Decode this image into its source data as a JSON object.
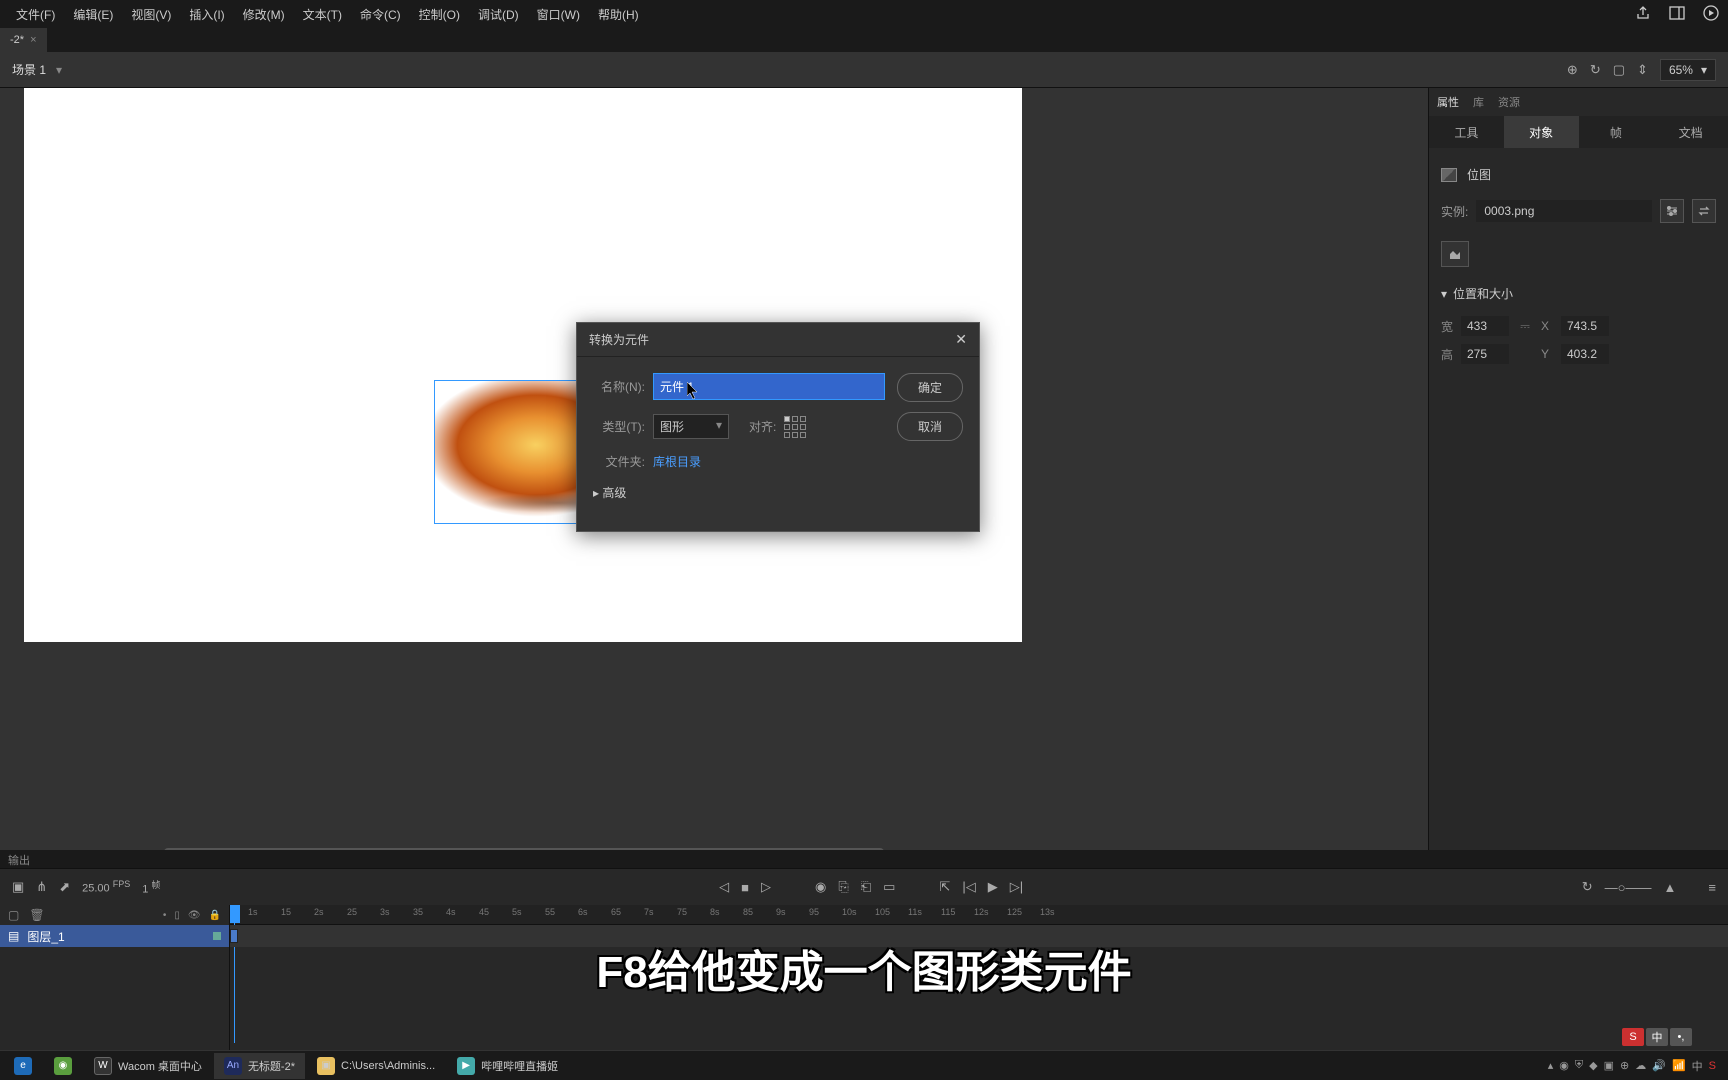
{
  "menubar": {
    "file": "文件(F)",
    "edit": "编辑(E)",
    "view": "视图(V)",
    "insert": "插入(I)",
    "modify": "修改(M)",
    "text": "文本(T)",
    "commands": "命令(C)",
    "control": "控制(O)",
    "debug": "调试(D)",
    "window": "窗口(W)",
    "help": "帮助(H)"
  },
  "doc_tab": {
    "name": "-2*"
  },
  "scene": {
    "name": "场景 1",
    "zoom": "65%"
  },
  "dialog": {
    "title": "转换为元件",
    "name_label": "名称(N):",
    "name_value": "元件 1",
    "type_label": "类型(T):",
    "type_value": "图形",
    "align_label": "对齐:",
    "folder_label": "文件夹:",
    "folder_value": "库根目录",
    "advanced": "高级",
    "ok": "确定",
    "cancel": "取消"
  },
  "panel": {
    "tabs_top": {
      "properties": "属性",
      "library": "库",
      "assets": "资源"
    },
    "tabs_sub": {
      "tool": "工具",
      "object": "对象",
      "frame": "帧",
      "doc": "文档"
    },
    "bitmap_label": "位图",
    "instance_label": "实例:",
    "instance_name": "0003.png",
    "section_pos": "位置和大小",
    "w_label": "宽",
    "w_val": "433",
    "h_label": "高",
    "h_val": "275",
    "x_label": "X",
    "x_val": "743.5",
    "y_label": "Y",
    "y_val": "403.2"
  },
  "output_label": "输出",
  "timeline": {
    "fps": "25.00",
    "fps_unit": "FPS",
    "frame": "1",
    "frame_unit": "帧",
    "layer_name": "图层_1",
    "ruler": [
      "1s",
      "15",
      "2s",
      "25",
      "3s",
      "35",
      "4s",
      "45",
      "5s",
      "55",
      "6s",
      "65",
      "7s",
      "75",
      "8s",
      "85",
      "9s",
      "95",
      "10s",
      "105",
      "11s",
      "115",
      "12s",
      "125",
      "13s"
    ]
  },
  "caption": "F8给他变成一个图形类元件",
  "taskbar": {
    "wacom": "Wacom 桌面中心",
    "animate": "无标题-2*",
    "explorer": "C:\\Users\\Adminis...",
    "bili": "哔哩哔哩直播姬"
  },
  "ime": {
    "s": "S",
    "zh": "中",
    "punct": "•,"
  },
  "tray": {
    "zh": "中"
  }
}
